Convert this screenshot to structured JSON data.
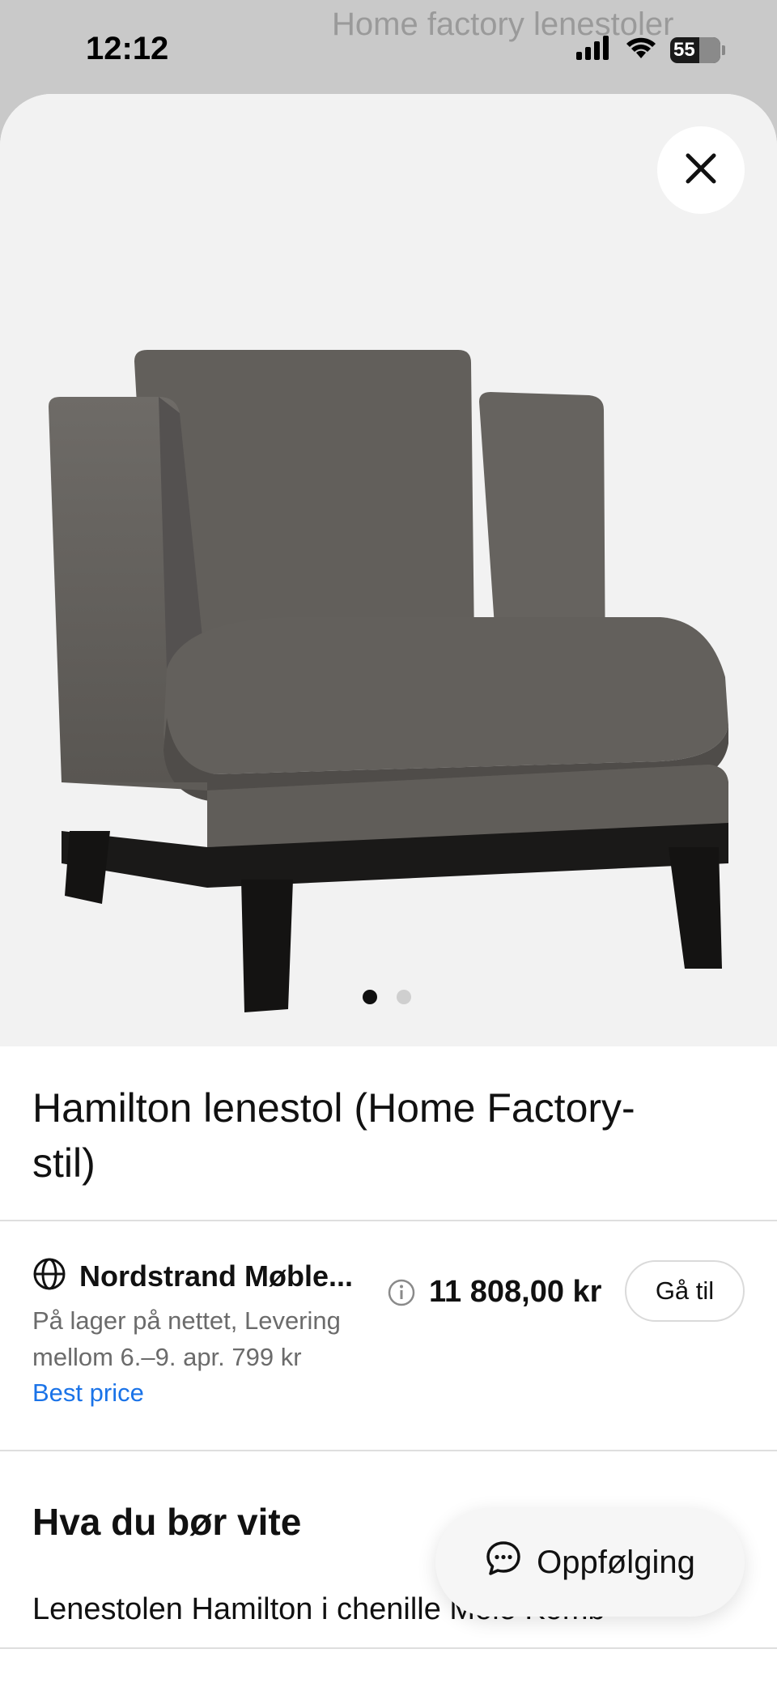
{
  "status_bar": {
    "time": "12:12",
    "battery": "55",
    "background_title": "Home factory lenestoler"
  },
  "icons": {
    "close": "close-icon",
    "globe": "globe-icon",
    "info": "info-icon",
    "chat": "chat-bubble-icon",
    "signal": "cellular-signal-icon",
    "wifi": "wifi-icon"
  },
  "carousel": {
    "total": 2,
    "active_index": 0
  },
  "product": {
    "title": "Hamilton lenestol (Home Factory-stil)"
  },
  "offer": {
    "seller": "Nordstrand Møble...",
    "availability": "På lager på nettet, Levering mellom 6.–9. apr. 799 kr",
    "best_price_label": "Best price",
    "price": "11 808,00 kr",
    "goto_label": "Gå til"
  },
  "section": {
    "title": "Hva du bør vite",
    "text": "Lenestolen Hamilton i chenille Mole Komb"
  },
  "followup_button": {
    "label": "Oppfølging"
  },
  "colors": {
    "link": "#1a73e8",
    "image_bg": "#f2f2f2",
    "status_bg": "#c9c9c9"
  }
}
